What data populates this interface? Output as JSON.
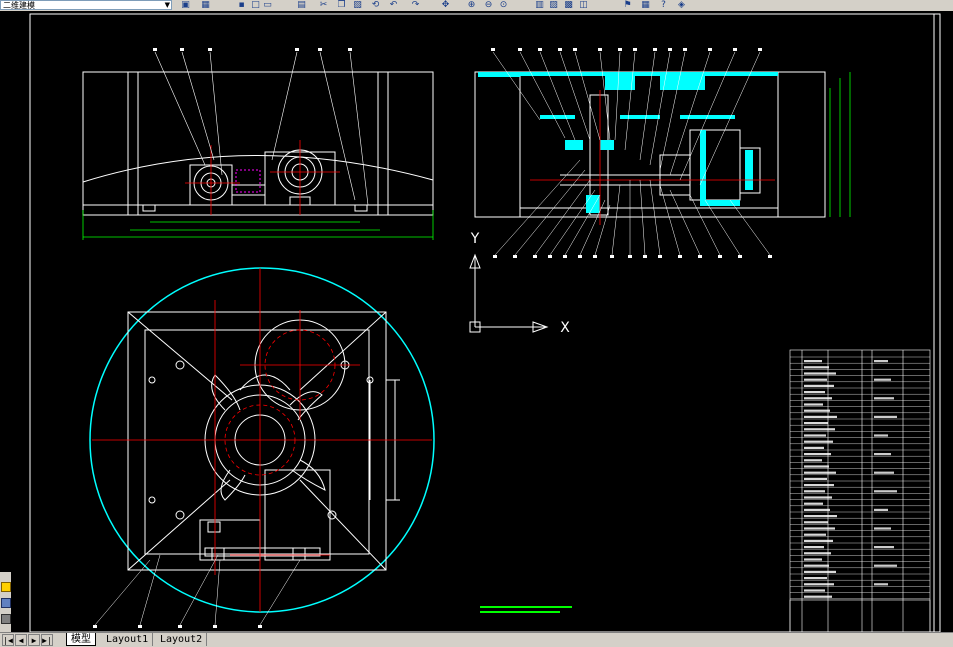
{
  "toolbar": {
    "workspace_value": "二维建模",
    "icons": [
      "properties-icon",
      "layer-icon",
      "save-icon",
      "new-icon",
      "open-icon",
      "print-icon",
      "cut-icon",
      "copy-icon",
      "paste-icon",
      "match-icon",
      "undo-icon",
      "redo-icon",
      "pan-icon",
      "zoom-realtime-icon",
      "zoom-window-icon",
      "zoom-previous-icon",
      "properties-palette-icon",
      "design-center-icon",
      "tool-palette-icon",
      "sheet-set-icon",
      "markup-icon",
      "calculator-icon",
      "help-icon",
      "layer-manager-icon"
    ]
  },
  "ucs": {
    "x_label": "X",
    "y_label": "Y"
  },
  "tabs": [
    {
      "label": "模型",
      "active": true
    },
    {
      "label": "Layout1",
      "active": false
    },
    {
      "label": "Layout2",
      "active": false
    }
  ],
  "colors": {
    "background": "#000000",
    "outline": "#ffffff",
    "centerline": "#ff0000",
    "dimension": "#00ffff",
    "hatch": "#00ffff",
    "highlight": "#ff00ff",
    "green": "#00ff00",
    "chrome": "#d4d0c8"
  }
}
